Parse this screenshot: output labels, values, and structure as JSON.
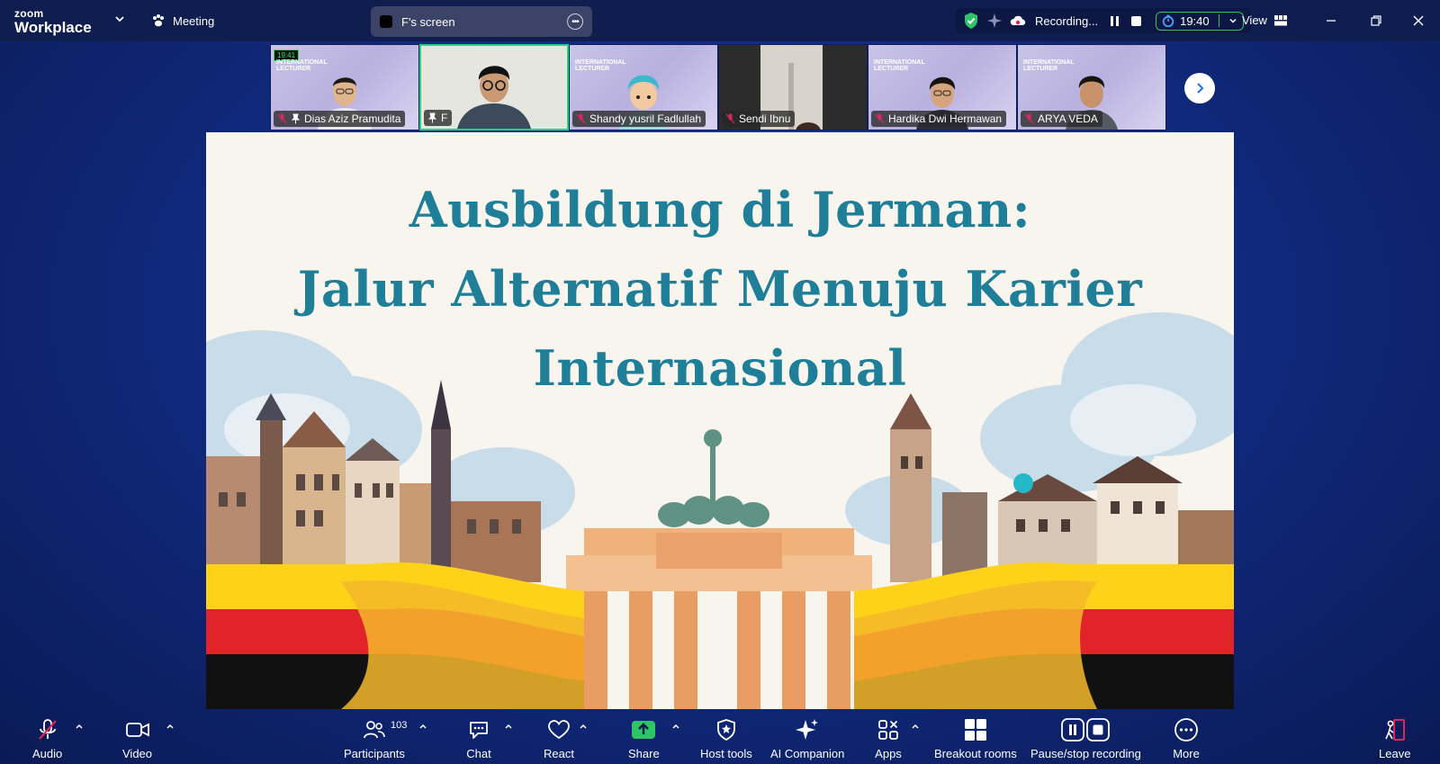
{
  "topbar": {
    "brand_small": "zoom",
    "brand_large": "Workplace",
    "meeting_label": "Meeting",
    "screen_label": "F's screen",
    "recording_label": "Recording...",
    "timer": "19:40",
    "view_label": "View"
  },
  "participants_strip": [
    {
      "name": "Dias Aziz Pramudita",
      "badge": "19:41"
    },
    {
      "name": "F"
    },
    {
      "name": "Shandy yusril Fadlullah"
    },
    {
      "name": "Sendi Ibnu"
    },
    {
      "name": "Hardika Dwi Hermawan"
    },
    {
      "name": "ARYA VEDA"
    }
  ],
  "thumb_banner": "INTERNATIONAL\nLECTURER",
  "slide": {
    "line1": "Ausbildung di Jerman:",
    "line2": "Jalur Alternatif Menuju Karier",
    "line3": "Internasional"
  },
  "toolbar": {
    "audio": "Audio",
    "video": "Video",
    "participants": "Participants",
    "participants_count": "103",
    "chat": "Chat",
    "react": "React",
    "share": "Share",
    "host_tools": "Host tools",
    "ai_companion": "AI Companion",
    "apps": "Apps",
    "breakout": "Breakout rooms",
    "pause_stop": "Pause/stop recording",
    "more": "More",
    "leave": "Leave"
  },
  "colors": {
    "title_teal": "#1f7f98",
    "active_green": "#27d07a",
    "share_green": "#2fc36a",
    "leave_red": "#e0245e"
  }
}
